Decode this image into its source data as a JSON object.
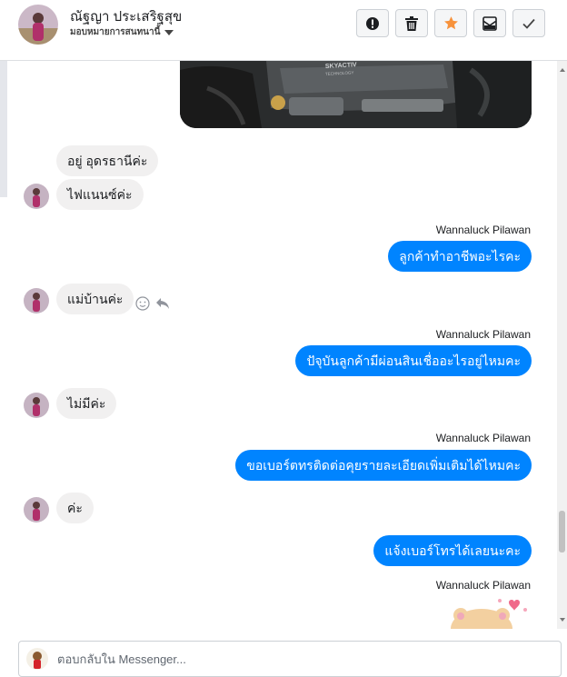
{
  "header": {
    "name": "ณัฐญา ประเสริฐสุข",
    "subtitle": "มอบหมายการสนทนานี้",
    "buttons": [
      {
        "name": "alert-button",
        "icon": "exclamation-circle-icon"
      },
      {
        "name": "delete-button",
        "icon": "trash-icon"
      },
      {
        "name": "star-button",
        "icon": "star-icon",
        "color": "#f7923b"
      },
      {
        "name": "mark-unread-button",
        "icon": "envelope-icon"
      },
      {
        "name": "mark-done-button",
        "icon": "checkmark-icon"
      }
    ]
  },
  "messages": [
    {
      "dir": "in",
      "text": "อยู่ อุดรธานีค่ะ"
    },
    {
      "dir": "in",
      "text": "ไฟแนนซ์ค่ะ"
    },
    {
      "dir": "out",
      "sender": "Wannaluck Pilawan",
      "text": "ลูกค้าทำอาชีพอะไรคะ"
    },
    {
      "dir": "in",
      "text": "แม่บ้านค่ะ"
    },
    {
      "dir": "out",
      "sender": "Wannaluck Pilawan",
      "text": "ปัจุบันลูกค้ามีผ่อนสินเชื่ออะไรอยู่ไหมคะ"
    },
    {
      "dir": "in",
      "text": "ไม่มีค่ะ"
    },
    {
      "dir": "out",
      "sender": "Wannaluck Pilawan",
      "text": "ขอเบอร์ตทรติดต่อคุยรายละเอียดเพิ่มเติมได้ไหมคะ"
    },
    {
      "dir": "in",
      "text": "ค่ะ"
    },
    {
      "dir": "out",
      "text": "แจ้งเบอร์โทรได้เลยนะคะ"
    },
    {
      "dir": "out",
      "sender": "Wannaluck Pilawan",
      "type": "sticker"
    }
  ],
  "photo": {
    "label": "SKYACTIV",
    "sublabel": "TECHNOLOGY"
  },
  "colors": {
    "outgoing_bubble": "#0084ff",
    "incoming_bubble": "#f1f0f0"
  },
  "composer": {
    "placeholder": "ตอบกลับใน Messenger..."
  }
}
